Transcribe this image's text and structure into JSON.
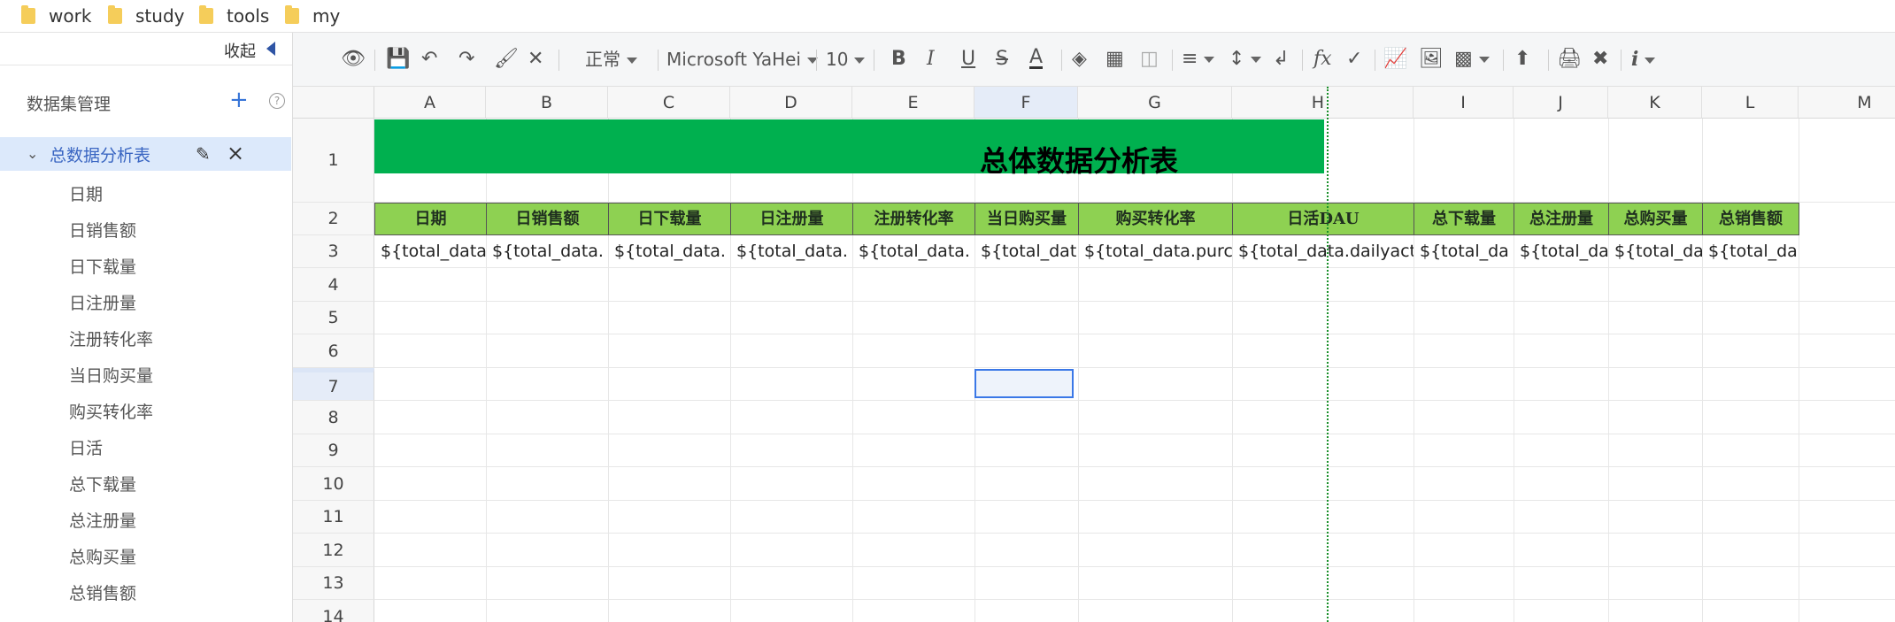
{
  "bookmarks": [
    "work",
    "study",
    "tools",
    "my"
  ],
  "left_panel": {
    "collapse_label": "收起",
    "dataset_title": "数据集管理",
    "add_label": "+",
    "help_label": "?",
    "dataset_name": "总数据分析表",
    "fields": [
      "日期",
      "日销售额",
      "日下载量",
      "日注册量",
      "注册转化率",
      "当日购买量",
      "购买转化率",
      "日活",
      "总下载量",
      "总注册量",
      "总购买量",
      "总销售额"
    ]
  },
  "toolbar": {
    "style_select": "正常",
    "font_select": "Microsoft YaHei",
    "size_select": "10"
  },
  "sheet": {
    "columns": [
      "A",
      "B",
      "C",
      "D",
      "E",
      "F",
      "G",
      "H",
      "I",
      "J",
      "K",
      "L",
      "M"
    ],
    "selected_column": "F",
    "rows": [
      "1",
      "2",
      "3",
      "4",
      "5",
      "6",
      "7",
      "8",
      "9",
      "10",
      "11",
      "12",
      "13",
      "14"
    ],
    "selected_row": "7",
    "title": "总体数据分析表",
    "header_cells": [
      "日期",
      "日销售额",
      "日下载量",
      "日注册量",
      "注册转化率",
      "当日购买量",
      "购买转化率",
      "日活DAU",
      "总下载量",
      "总注册量",
      "总购买量",
      "总销售额"
    ],
    "value_cells": [
      "${total_data",
      "${total_data.",
      "${total_data.",
      "${total_data.",
      "${total_data.",
      "${total_dat",
      "${total_data.purc",
      "${total_data.dailyacti",
      "${total_da",
      "${total_da",
      "${total_da",
      "${total_da"
    ]
  },
  "colors": {
    "title_fill": "#00b04f",
    "header_fill": "#8ed152",
    "selection": "#3b78e7",
    "accent": "#3a66c2"
  }
}
